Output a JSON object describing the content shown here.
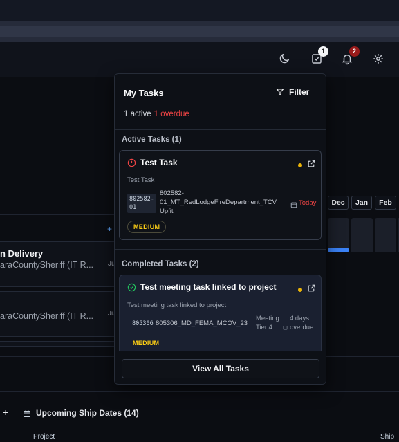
{
  "header": {
    "tasks_badge": "1",
    "notifications_badge": "2",
    "icons": [
      "moon-icon",
      "tasks-check-icon",
      "bell-icon",
      "gear-icon"
    ]
  },
  "background": {
    "card1_title": "n Delivery",
    "card1_sub": "araCountySheriff (IT R...",
    "card1_date": "Ju",
    "card2_sub": "araCountySheriff (IT R...",
    "card2_date": "Ju",
    "plus": "+",
    "months": [
      "Dec",
      "Jan",
      "Feb"
    ],
    "upcoming_plus": "+",
    "upcoming_label": "Upcoming Ship Dates (14)",
    "col_project": "Project",
    "col_ship": "Ship"
  },
  "panel": {
    "title": "My Tasks",
    "filter_label": "Filter",
    "active_count": "1 active",
    "overdue_count": "1 overdue",
    "active_section": "Active Tasks (1)",
    "completed_section": "Completed Tasks (2)",
    "active_task": {
      "title": "Test Task",
      "description": "Test Task",
      "code_line1": "802582-",
      "code_line2": "01",
      "project_line1": "802582-",
      "project_line2": "01_MT_RedLodgeFireDepartment_TCV",
      "project_line3": "Upfit",
      "due": "Today",
      "priority": "MEDIUM"
    },
    "completed_task": {
      "title": "Test meeting task linked to project",
      "description": "Test meeting task linked to project",
      "code": "805306",
      "project": "805306_MD_FEMA_MCOV_23",
      "meeting_line1": "Meeting:",
      "meeting_line2": "Tier 4",
      "due_line1": "4 days",
      "due_line2": "overdue",
      "priority": "MEDIUM"
    },
    "view_all": "View All Tasks"
  },
  "colors": {
    "accent_yellow": "#eab308",
    "overdue_red": "#ef4444",
    "completed_green": "#22c55e",
    "progress_blue": "#3b82f6"
  }
}
